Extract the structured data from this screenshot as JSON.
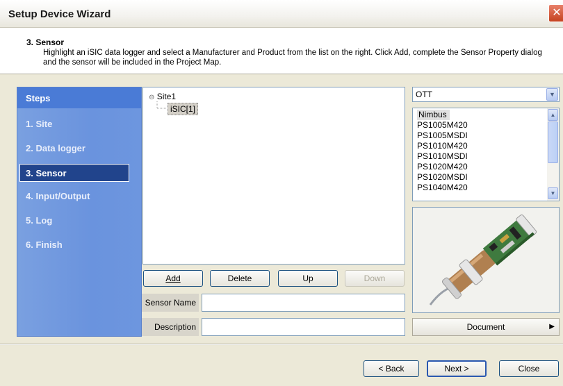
{
  "window": {
    "title": "Setup Device Wizard",
    "close_glyph": "✕"
  },
  "header": {
    "step_title": "3. Sensor",
    "description": "Highlight an iSIC data logger and select a Manufacturer and Product from the list on the right. Click Add, complete the Sensor Property dialog and the sensor will be included in the Project Map."
  },
  "steps": {
    "title": "Steps",
    "items": [
      {
        "label": "1. Site",
        "active": false
      },
      {
        "label": "2. Data logger",
        "active": false
      },
      {
        "label": "3. Sensor",
        "active": true
      },
      {
        "label": "4. Input/Output",
        "active": false
      },
      {
        "label": "5. Log",
        "active": false
      },
      {
        "label": "6. Finish",
        "active": false
      }
    ]
  },
  "tree": {
    "root_toggle": "⊖",
    "root_label": "Site1",
    "child_label": "iSIC[1]"
  },
  "actions": {
    "add_label": "Add",
    "delete_label": "Delete",
    "up_label": "Up",
    "down_label": "Down"
  },
  "fields": {
    "sensor_name_label": "Sensor Name",
    "sensor_name_value": "",
    "description_label": "Description",
    "description_value": ""
  },
  "manufacturer": {
    "selected": "OTT",
    "arrow_icon": "chevron-down-icon"
  },
  "products": {
    "items": [
      "Nimbus",
      "PS1005M420",
      "PS1005MSDI",
      "PS1010M420",
      "PS1010MSDI",
      "PS1020M420",
      "PS1020MSDI",
      "PS1040M420"
    ],
    "selected_index": 0
  },
  "document_label": "Document",
  "document_arrow": "▶",
  "footer": {
    "back_label": "< Back",
    "next_label": "Next >",
    "close_label": "Close"
  },
  "colors": {
    "steps_panel": "#6d96df",
    "steps_active": "#21448c",
    "close_button": "#c5421f"
  }
}
